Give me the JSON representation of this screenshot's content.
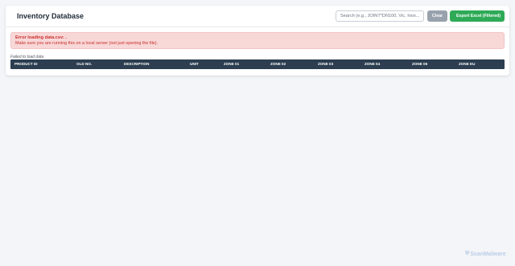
{
  "header": {
    "title_icon": "database-icon",
    "title_icon_glyph": "",
    "title": "Inventory Database"
  },
  "search": {
    "placeholder": "Search (e.g., JOINT*DN100, Vic, Inox...)",
    "value": ""
  },
  "toolbar": {
    "clear_label": "Clear",
    "export_icon_glyph": "",
    "export_label": "Export Excel (Filtered)"
  },
  "error": {
    "title": "Error loading data.csv: .",
    "message": "Make sure you are running this on a local server (not just opening the file)."
  },
  "status_text": "Failed to load data",
  "table": {
    "columns": [
      "PRODUCT ID",
      "OLD NO.",
      "DESCRIPTION",
      "UNIT",
      "ZONE 01",
      "ZONE 02",
      "ZONE 03",
      "ZONE 04",
      "ZONE 06",
      "ZONE EU"
    ],
    "rows": []
  },
  "watermark": {
    "icon_glyph": "⛨",
    "text": "ScanMalware"
  },
  "colors": {
    "page_bg": "#f4f5f8",
    "table_header_bg": "#2c3e50",
    "export_button": "#2eaa57",
    "clear_button": "#98a2ad",
    "error_bg": "#f8d7d7",
    "error_text": "#c9302c"
  }
}
